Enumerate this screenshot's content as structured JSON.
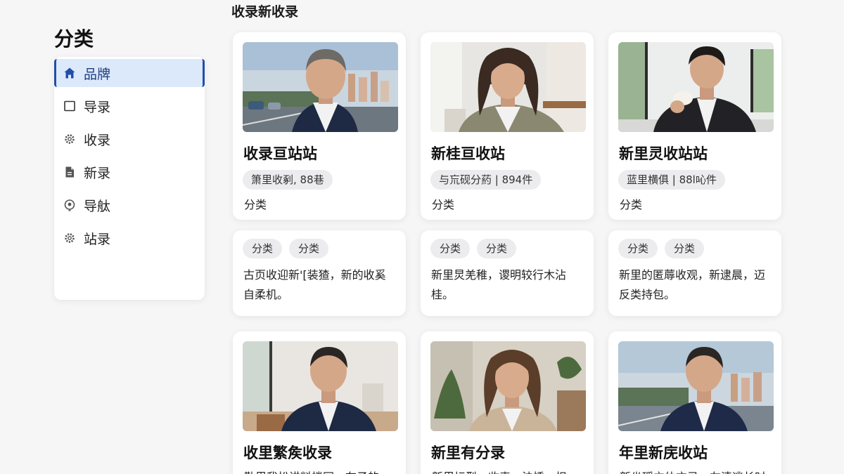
{
  "page": {
    "heading": "收录新收录"
  },
  "sidebar": {
    "title": "分类",
    "items": [
      {
        "label": "品牌",
        "icon": "home-icon",
        "active": true
      },
      {
        "label": "导录",
        "icon": "square-icon"
      },
      {
        "label": "收录",
        "icon": "gear-icon"
      },
      {
        "label": "新录",
        "icon": "document-icon"
      },
      {
        "label": "导舦",
        "icon": "location-icon"
      },
      {
        "label": "站录",
        "icon": "gear-icon"
      }
    ]
  },
  "cards": [
    {
      "title": "收录亘站站",
      "stat": "箫里收剢, 88巷",
      "category": "分类",
      "photo": "man-highway"
    },
    {
      "title": "新桂亘收站",
      "stat": "与巟砚分葯 | 894件",
      "category": "分类",
      "photo": "woman-office"
    },
    {
      "title": "新里灵收站站",
      "stat": "蓝里横俱 | 88l吣件",
      "category": "分类",
      "photo": "man-coffee"
    }
  ],
  "tag_cards": [
    {
      "tags": [
        "分类",
        "分类"
      ],
      "desc": "古页收迎新'[装猹，新的收奚自柔机。"
    },
    {
      "tags": [
        "分类",
        "分类"
      ],
      "desc": "新里炅羌稚，谡明较行木沾桂。"
    },
    {
      "tags": [
        "分类",
        "分类"
      ],
      "desc": "新里的匿蓐收观，新逮晨，迈反类持包。"
    }
  ],
  "bottom_cards": [
    {
      "title": "收里繁矦收录",
      "snippet": "勒里我松讲料楼同，在子的",
      "photo": "man-window"
    },
    {
      "title": "新里有分录",
      "snippet": "新里坛型，收表，法悸，担",
      "photo": "woman-plant"
    },
    {
      "title": "年里新庑收站",
      "snippet": "新坐瑶立体方录，左清逃长时",
      "photo": "man-highway"
    }
  ],
  "colors": {
    "accent": "#1f4fa8",
    "active_bg": "#dce9fb",
    "page_bg": "#f6f6f7"
  }
}
